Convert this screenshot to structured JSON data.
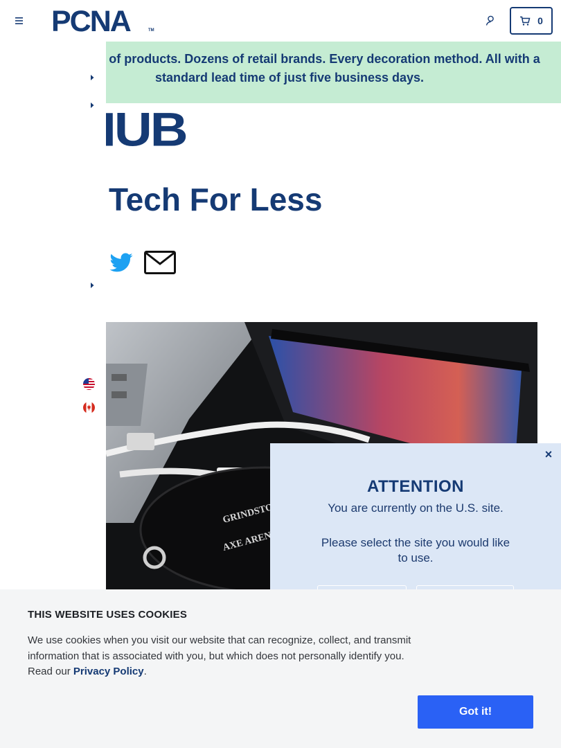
{
  "header": {
    "logo_text": "PCNA",
    "logo_tm": "TM",
    "cart_count": "0",
    "menu_icon": "hamburger-icon",
    "account_icon": "user-icon",
    "cart_icon": "cart-icon"
  },
  "banner": {
    "text": "Thousands of products. Dozens of retail brands. Every decoration method. All with a standard lead time of just five business days."
  },
  "article": {
    "hub_logo": "HUB",
    "title": "Tech For Less",
    "share_icons": [
      "twitter-icon",
      "email-icon"
    ],
    "hero_text_line1": "GRINDSTONE",
    "hero_text_line2": "AXE ARENA"
  },
  "sidebar": {
    "flags": [
      "us-flag-icon",
      "canada-flag-icon"
    ]
  },
  "attention": {
    "title": "ATTENTION",
    "line1": "You are currently on the U.S. site.",
    "line2": "Please select the site you would like to use.",
    "close_label": "×"
  },
  "cookie": {
    "title": "THIS WEBSITE USES COOKIES",
    "text": "We use cookies when you visit our website that can recognize, collect, and transmit information that is associated with you, but which does not personally identify you. Read our",
    "link": "Privacy Policy",
    "period": ".",
    "button": "Got it!"
  },
  "colors": {
    "brand_navy": "#153a74",
    "banner_green": "#c5ecd3",
    "popup_blue": "#dce7f6",
    "cookie_button": "#2a61f5"
  }
}
